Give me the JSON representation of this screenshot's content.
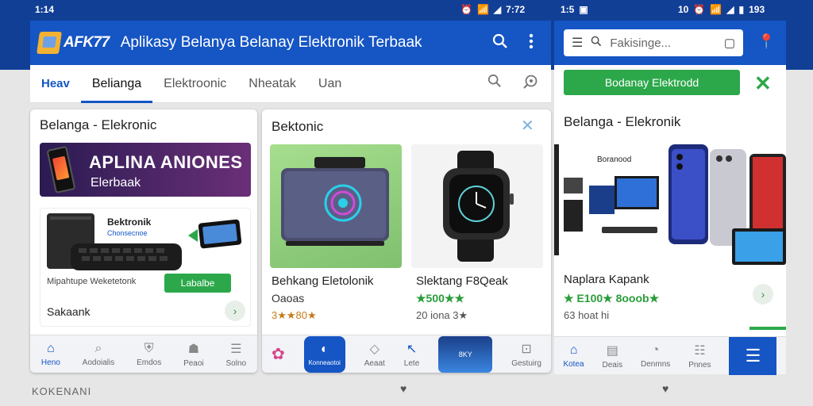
{
  "status_left": {
    "time": "1:14"
  },
  "status_mid": {
    "time": "7:72"
  },
  "status_right": {
    "time": "1:5",
    "right": "10",
    "battery": "193"
  },
  "appbar": {
    "logo": "AFK77",
    "title": "Aplikasy Belanya Belanay Elektronik Terbaak"
  },
  "tabs": [
    {
      "label": "Heav"
    },
    {
      "label": "Belianga"
    },
    {
      "label": "Elektroonic"
    },
    {
      "label": "Nheatak"
    },
    {
      "label": "Uan"
    }
  ],
  "card1": {
    "title": "Belanga - Elekronic",
    "banner_heading": "APLINA ANIONES",
    "banner_sub": "Elerbaak",
    "sub_label": "Bektronik",
    "sub_small": "Chonsecnoe",
    "sub_desc": "Mipahtupe Weketetonk",
    "sub_button": "Labalbe",
    "footer_label": "Sakaank"
  },
  "card2": {
    "title": "Bektonic",
    "product1": {
      "name": "Behkang Eletolonik",
      "price": "Oaoas",
      "rating": "3★★80★"
    },
    "product2": {
      "name": "Slektang F8Qeak",
      "price": "★500★★",
      "rating": "20 iona 3★"
    }
  },
  "nav1": [
    {
      "label": "Heno",
      "icon": "home-icon"
    },
    {
      "label": "Aodoialis",
      "icon": "search-icon"
    },
    {
      "label": "Emdos",
      "icon": "shield-icon"
    },
    {
      "label": "Peaoi",
      "icon": "people-icon"
    },
    {
      "label": "Solno",
      "icon": "menu-icon"
    }
  ],
  "nav2": [
    {
      "label": "",
      "icon": "pinwheel-icon"
    },
    {
      "label": "Konneaotoi",
      "icon": "app-icon"
    },
    {
      "label": "Aeaat",
      "icon": "drop-icon"
    },
    {
      "label": "Lete",
      "icon": "cursor-icon"
    },
    {
      "label": "8KY",
      "icon": "phone-icon"
    },
    {
      "label": "Gestuirg",
      "icon": "cart-icon"
    }
  ],
  "right_panel": {
    "search_placeholder": "Fakisinge...",
    "green_button": "Bodanay Elektrodd",
    "title": "Belanga - Elekronik",
    "hero_label": "Boranood",
    "product_name": "Naplara Kapank",
    "price": "★ E100★ 8ooob★",
    "rating": "63 hoat hi"
  },
  "nav3": [
    {
      "label": "Kotea",
      "icon": "home-icon"
    },
    {
      "label": "Deais",
      "icon": "chart-icon"
    },
    {
      "label": "Denmns",
      "icon": "chat-icon"
    },
    {
      "label": "Pnnes",
      "icon": "list-icon"
    }
  ],
  "bottom_text": "KOKENANI",
  "colors": {
    "brand_blue": "#1555c4",
    "accent_green": "#2ca84a",
    "band": "#123f96"
  }
}
